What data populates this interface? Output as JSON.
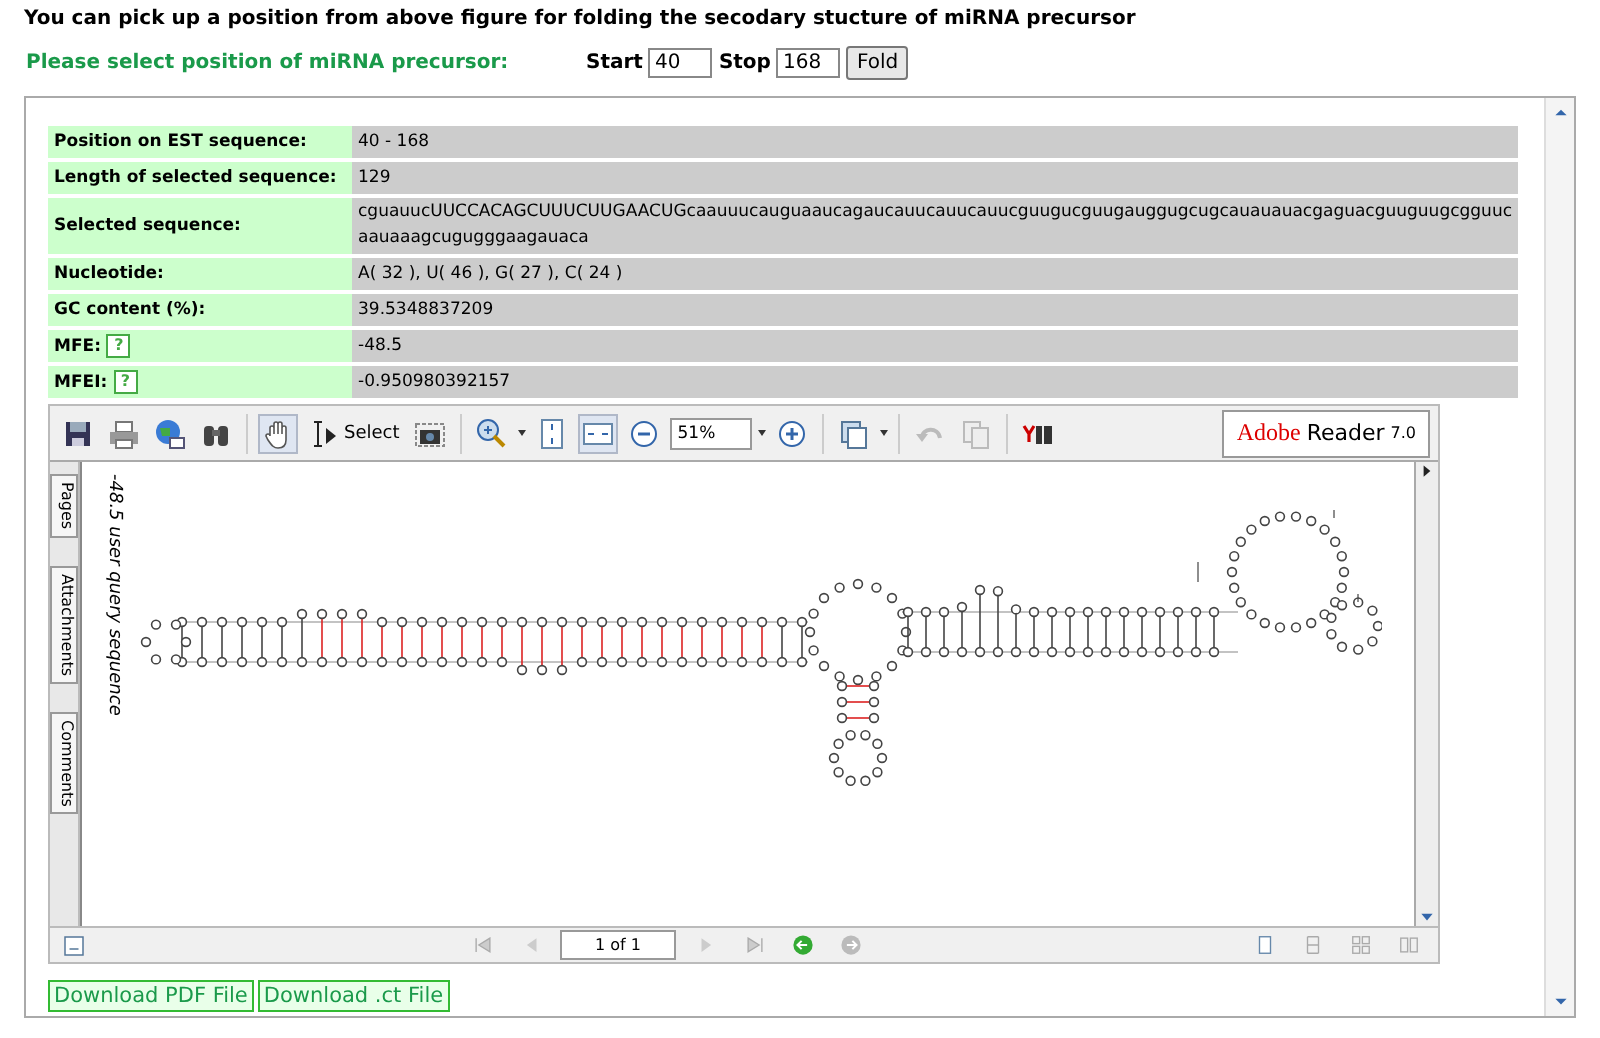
{
  "heading": "You can pick up a position from above figure for folding the secodary stucture of miRNA precursor",
  "selector": {
    "label": "Please select position of miRNA precursor:",
    "start_label": "Start",
    "start_value": "40",
    "stop_label": "Stop",
    "stop_value": "168",
    "button": "Fold"
  },
  "info_rows": [
    {
      "label": "Position on EST sequence:",
      "value": "40 - 168",
      "help": false
    },
    {
      "label": "Length of selected sequence:",
      "value": "129",
      "help": false
    },
    {
      "label": "Selected sequence:",
      "value": "cguauucUUCCACAGCUUUCUUGAACUGcaauuucauguaaucagaucauucauucauucguugucguugauggugcugcauauauacgaguacguuguugcgguucaauaaagcugugggaagauaca",
      "help": false
    },
    {
      "label": "Nucleotide:",
      "value": "A( 32 ), U( 46 ), G( 27 ), C( 24 )",
      "help": false
    },
    {
      "label": "GC content (%):",
      "value": "39.5348837209",
      "help": false
    },
    {
      "label": "MFE:",
      "value": "-48.5",
      "help": true,
      "help_text": "?"
    },
    {
      "label": "MFEI:",
      "value": "-0.950980392157",
      "help": true,
      "help_text": "?"
    }
  ],
  "pdf_viewer": {
    "tools": [
      {
        "kind": "hand",
        "selected": true
      },
      {
        "kind": "select",
        "label": "Select",
        "selected": false
      },
      {
        "kind": "snapshot",
        "selected": false
      }
    ],
    "fit": [
      {
        "kind": "fit-page",
        "selected": false
      },
      {
        "kind": "fit-width",
        "selected": true
      }
    ],
    "zoom": "51%",
    "logo": {
      "brand": "Adobe",
      "product": "Reader",
      "version": "7.0"
    },
    "side_tabs": [
      "Pages",
      "Attachments",
      "Comments"
    ],
    "document_title": "-48.5 user query sequence",
    "page_field": "1 of 1"
  },
  "downloads": [
    "Download PDF File",
    "Download .ct File"
  ]
}
